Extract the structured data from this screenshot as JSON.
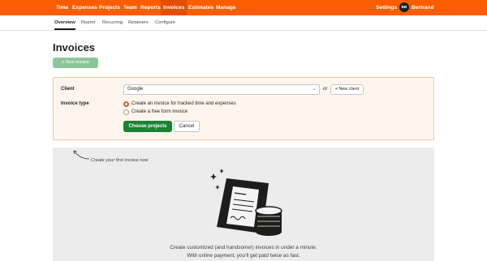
{
  "topnav": {
    "items": [
      "Time",
      "Expenses",
      "Projects",
      "Team",
      "Reports",
      "Invoices",
      "Estimates",
      "Manage"
    ],
    "active": "Invoices",
    "settings_label": "Settings",
    "avatar_initials": "BB",
    "user_name": "Bertrand",
    "colors": {
      "bar": "#fa5d00",
      "active": "#e44e00"
    }
  },
  "subnav": {
    "items": [
      "Overview",
      "Report",
      "Recurring",
      "Retainers",
      "Configure"
    ],
    "active": "Overview"
  },
  "main": {
    "title": "Invoices",
    "new_invoice_label": "+ New invoice"
  },
  "form": {
    "client_label": "Client",
    "client_value": "Google",
    "or_text": "or",
    "new_client_label": "+ New client",
    "invoice_type_label": "Invoice type",
    "options": [
      {
        "label": "Create an invoice for tracked time and expenses",
        "selected": true
      },
      {
        "label": "Create a free form invoice",
        "selected": false
      }
    ],
    "primary_label": "Choose projects",
    "cancel_label": "Cancel",
    "colors": {
      "panel": "#fdf5ed",
      "primary": "#188433",
      "radio": "#e25c2a"
    }
  },
  "empty_state": {
    "hint": "Create your first invoice now",
    "line1": "Create customized (and handsome!) invoices in under a minute.",
    "line2": "With online payment, you’ll get paid twice as fast."
  }
}
